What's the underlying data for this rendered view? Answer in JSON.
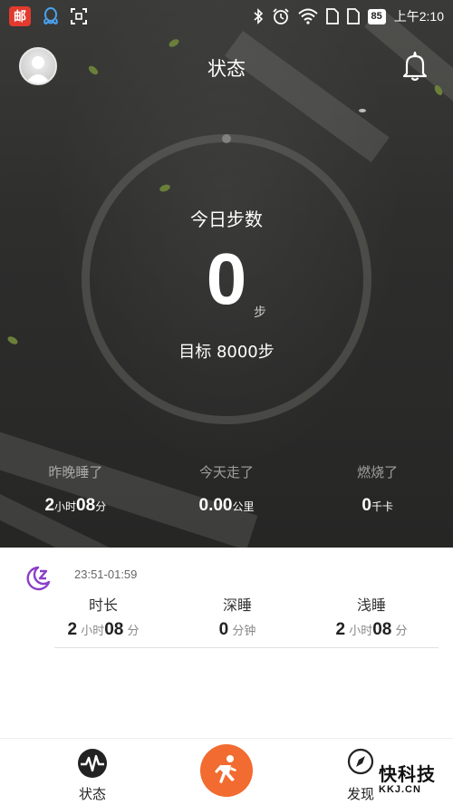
{
  "status_bar": {
    "mail_badge": "邮",
    "battery": "85",
    "time": "上午2:10"
  },
  "header": {
    "title": "状态"
  },
  "steps": {
    "label": "今日步数",
    "value": "0",
    "unit": "步",
    "goal": "目标 8000步"
  },
  "summary": [
    {
      "label": "昨晚睡了",
      "value1": "2",
      "unit1": "小时",
      "value2": "08",
      "unit2": "分"
    },
    {
      "label": "今天走了",
      "value1": "0.00",
      "unit1": "公里"
    },
    {
      "label": "燃烧了",
      "value1": "0",
      "unit1": "千卡"
    }
  ],
  "sleep": {
    "time_range": "23:51-01:59",
    "duration": {
      "label": "时长",
      "value1": "2",
      "unit1": "小时",
      "value2": "08",
      "unit2": "分"
    },
    "deep": {
      "label": "深睡",
      "value1": "0",
      "unit1": "分钟"
    },
    "light": {
      "label": "浅睡",
      "value1": "2",
      "unit1": "小时",
      "value2": "08",
      "unit2": "分"
    }
  },
  "nav": {
    "status_label": "状态",
    "discover_label": "发现"
  },
  "watermark": {
    "line1": "快科技",
    "line2": "KKJ.CN"
  },
  "colors": {
    "accent_run": "#f26b30",
    "sleep_icon": "#8b3fc8"
  }
}
